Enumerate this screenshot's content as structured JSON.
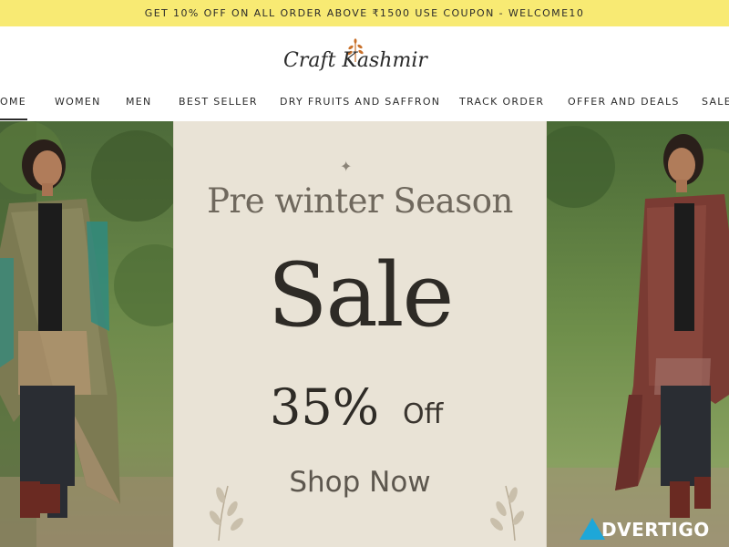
{
  "promo": {
    "text": "GET 10% OFF ON ALL ORDER ABOVE ₹1500 USE COUPON - WELCOME10"
  },
  "header": {
    "logo_text": "Craft Kashmir"
  },
  "nav": {
    "items": [
      "OME",
      "WOMEN",
      "MEN",
      "BEST SELLER",
      "DRY FRUITS AND SAFFRON",
      "TRACK ORDER",
      "OFFER AND DEALS",
      "SALE"
    ]
  },
  "hero": {
    "sparkle": "✦",
    "headline": "Pre winter Season",
    "sale": "Sale",
    "discount": "35%",
    "off": "Off",
    "cta": "Shop Now",
    "panel_color": "#e9e3d6"
  },
  "watermark": {
    "text": "DVERTIGO"
  },
  "colors": {
    "promo_bg": "#f8ea73",
    "accent": "#2e2b26"
  }
}
